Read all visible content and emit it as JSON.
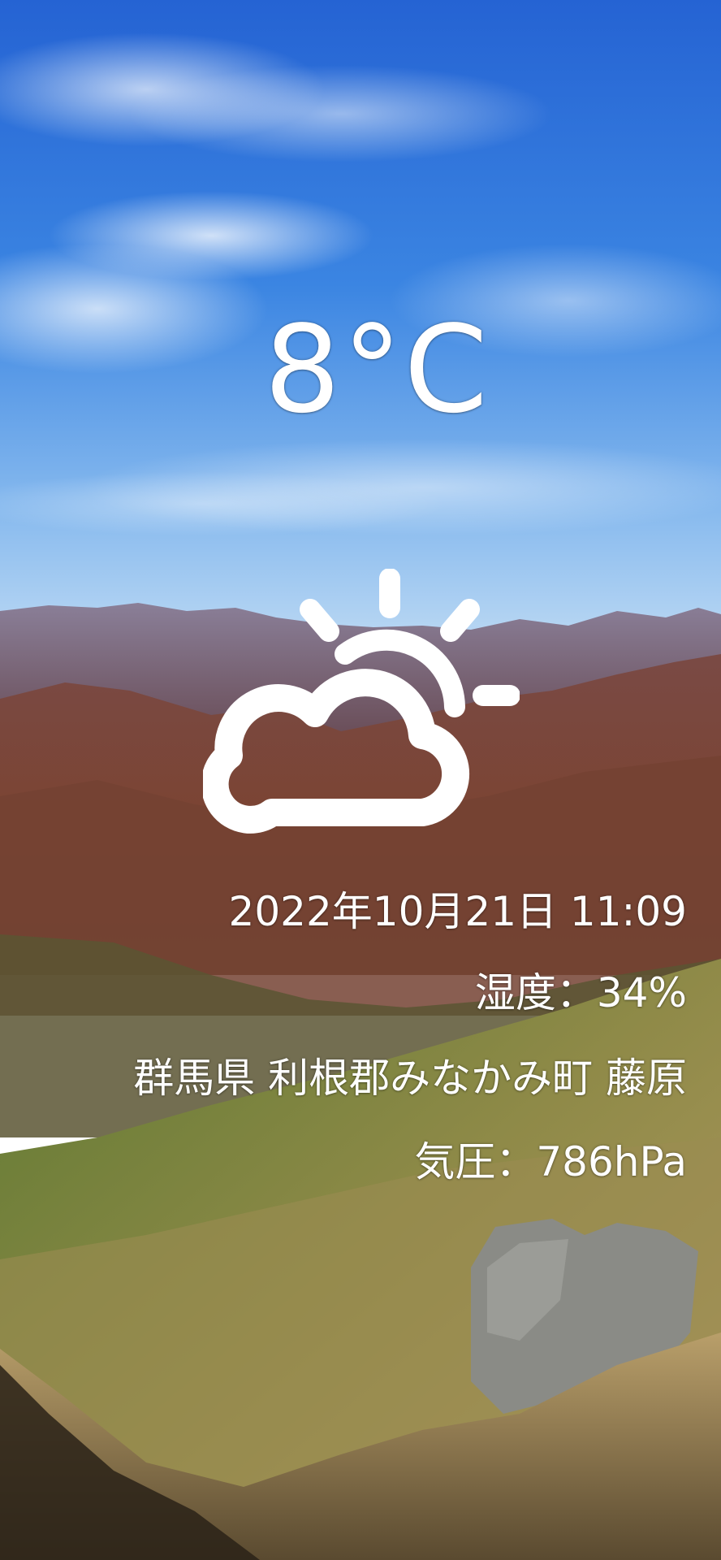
{
  "weather": {
    "temperature": "8°C",
    "condition_icon": "partly-cloudy-icon",
    "datetime": "2022年10月21日  11:09",
    "humidity": "湿度：34%",
    "location": "群馬県  利根郡みなかみ町  藤原",
    "pressure": "気圧：786hPa"
  },
  "colors": {
    "text": "#ffffff",
    "sky_top": "#2f6fd8",
    "sky_bottom": "#9cc6f2",
    "mountain_far": "#7a6a86",
    "mountain_mid": "#7c4a3c",
    "slope_green": "#5e7d34",
    "slope_dry": "#a89460",
    "rock": "#8b8c88"
  }
}
